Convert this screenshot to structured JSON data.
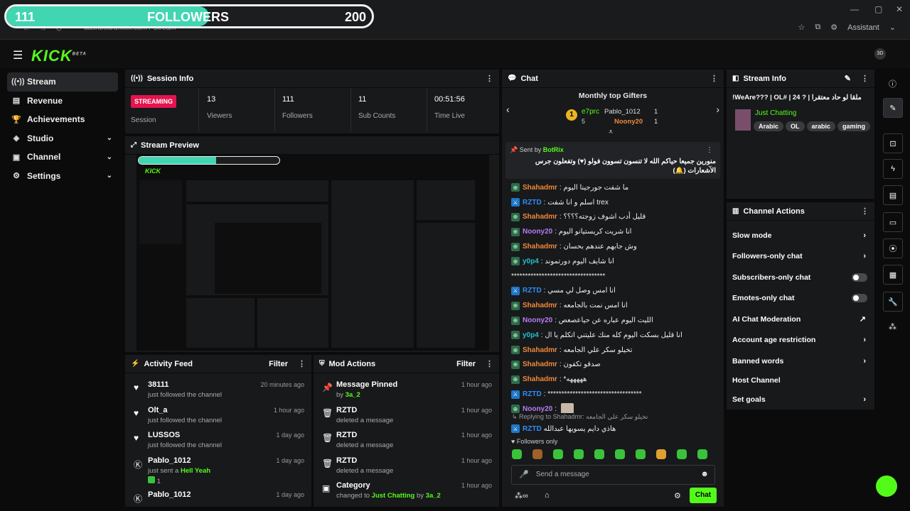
{
  "browser": {
    "address": "dashboard.kick.com / Stream",
    "assistant_label": "Assistant"
  },
  "follower_goal": {
    "current": "111",
    "label": "FOLLOWERS",
    "target": "200",
    "progress": 0.555
  },
  "sidebar": {
    "items": [
      {
        "label": "Stream",
        "icon": "stream-icon",
        "active": true
      },
      {
        "label": "Revenue",
        "icon": "revenue-icon"
      },
      {
        "label": "Achievements",
        "icon": "trophy-icon"
      },
      {
        "label": "Studio",
        "icon": "studio-icon",
        "expandable": true
      },
      {
        "label": "Channel",
        "icon": "channel-icon",
        "expandable": true
      },
      {
        "label": "Settings",
        "icon": "gear-icon",
        "expandable": true
      }
    ]
  },
  "session": {
    "title": "Session Info",
    "status": "STREAMING",
    "status_label": "Session",
    "stats": [
      {
        "value": "13",
        "label": "Viewers"
      },
      {
        "value": "111",
        "label": "Followers"
      },
      {
        "value": "11",
        "label": "Sub Counts"
      },
      {
        "value": "00:51:56",
        "label": "Time Live"
      }
    ]
  },
  "preview": {
    "title": "Stream Preview"
  },
  "activity": {
    "title": "Activity Feed",
    "filter": "Filter",
    "items": [
      {
        "name": "38111",
        "desc": "just followed the channel",
        "time": "20 minutes ago",
        "icon": "heart-icon"
      },
      {
        "name": "Olt_a",
        "desc": "just followed the channel",
        "time": "1 hour ago",
        "icon": "heart-icon"
      },
      {
        "name": "LUSSOS",
        "desc": "just followed the channel",
        "time": "1 day ago",
        "icon": "heart-icon"
      },
      {
        "name": "Pablo_1012",
        "desc": "just sent a",
        "highlight": "Hell Yeah",
        "extra": "1",
        "time": "1 day ago",
        "icon": "kick-icon"
      },
      {
        "name": "Pablo_1012",
        "desc": "",
        "time": "1 day ago",
        "icon": "kick-icon"
      }
    ]
  },
  "mod_actions": {
    "title": "Mod Actions",
    "filter": "Filter",
    "items": [
      {
        "name": "Message Pinned",
        "desc_pre": "by",
        "desc_hl": "3a_2",
        "time": "1 hour ago",
        "icon": "pin-icon"
      },
      {
        "name": "RZTD",
        "desc_pre": "deleted a message",
        "desc_hl": "",
        "time": "1 hour ago",
        "icon": "trash-icon"
      },
      {
        "name": "RZTD",
        "desc_pre": "deleted a message",
        "desc_hl": "",
        "time": "1 hour ago",
        "icon": "trash-icon"
      },
      {
        "name": "RZTD",
        "desc_pre": "deleted a message",
        "desc_hl": "",
        "time": "1 hour ago",
        "icon": "trash-icon"
      },
      {
        "name": "Category",
        "desc_pre": "changed to",
        "desc_hl": "Just Chatting",
        "desc_post": "by",
        "desc_hl2": "3a_2",
        "time": "1 hour ago",
        "icon": "category-icon"
      }
    ]
  },
  "chat": {
    "title": "Chat",
    "gifters_title": "Monthly top Gifters",
    "gifters": [
      {
        "name": "e7prc",
        "count": "5",
        "rank": "1"
      },
      {
        "name": "Pablo_1012",
        "count": "1"
      },
      {
        "name": "Noony20",
        "count": "1"
      }
    ],
    "pinned": {
      "sent_by": "Sent by",
      "author": "BotRix",
      "text": "منورين جميعا حياكم الله لا تنسون تسوون فولو (♥) وتفعلون جرس الاشعارات (🔔)"
    },
    "messages": [
      {
        "user": "Shahadmr",
        "color": "#f0883a",
        "text": "ما شفت جورجينا اليوم",
        "badge": "vip"
      },
      {
        "user": "RZTD",
        "color": "#2f8ef5",
        "text": "اسلم و انا شفت trex",
        "badge": "mod"
      },
      {
        "user": "Shahadmr",
        "color": "#f0883a",
        "text": "قليل أدب اشوف زوجته؟؟؟؟",
        "badge": "vip"
      },
      {
        "user": "Noony20",
        "color": "#b77cf5",
        "text": "انا شريت كريستيانو اليوم",
        "badge": "vip"
      },
      {
        "user": "Shahadmr",
        "color": "#f0883a",
        "text": "وش جابهم عندهم بحسان",
        "badge": "vip"
      },
      {
        "user": "y0p4",
        "color": "#21c0c8",
        "text": "انا شايف اليوم دورتموند",
        "badge": "vip"
      },
      {
        "user": "",
        "color": "#ffffff",
        "text": "**********************************",
        "badge": ""
      },
      {
        "user": "RZTD",
        "color": "#2f8ef5",
        "text": "انا امس وصل لي مسي",
        "badge": "mod"
      },
      {
        "user": "Shahadmr",
        "color": "#f0883a",
        "text": "انا امس نمت بالجامعه",
        "badge": "vip"
      },
      {
        "user": "Noony20",
        "color": "#b77cf5",
        "text": "الليت الیوم عباره عن حیاعصعص",
        "badge": "vip"
      },
      {
        "user": "y0p4",
        "color": "#21c0c8",
        "text": "انا قليل بسكت اليوم كله منك عليتني اتكلم يا ال",
        "badge": "vip"
      },
      {
        "user": "Shahadmr",
        "color": "#f0883a",
        "text": "تخيلو سكر علي الجامعه",
        "badge": "vip"
      },
      {
        "user": "Shahadmr",
        "color": "#f0883a",
        "text": "صدقو تكفون",
        "badge": "vip"
      },
      {
        "user": "Shahadmr",
        "color": "#f0883a",
        "text": "*هههههه",
        "badge": "vip"
      },
      {
        "user": "RZTD",
        "color": "#2f8ef5",
        "text": "**********************************",
        "badge": "mod"
      },
      {
        "user": "Noony20",
        "color": "#b77cf5",
        "text": "",
        "badge": "vip"
      }
    ],
    "reply": {
      "label": "Replying to Shahadmr:",
      "quoted": "تخيلو سكر علي الجامعه",
      "user": "RZTD",
      "text": "هاذي دايم يسويها عبدالله"
    },
    "followers_only": "Followers only",
    "placeholder": "Send a message",
    "send": "Chat"
  },
  "stream_info": {
    "title": "Stream Info",
    "stream_title": "ملقا لو حاد معتقرا | ? 24 | #WeAre??? | OL!",
    "category": "Just Chatting",
    "tags": [
      "Arabic",
      "OL",
      "arabic",
      "gaming"
    ]
  },
  "channel_actions": {
    "title": "Channel Actions",
    "items": [
      {
        "label": "Slow mode",
        "type": "arrow"
      },
      {
        "label": "Followers-only chat",
        "type": "arrow"
      },
      {
        "label": "Subscribers-only chat",
        "type": "toggle"
      },
      {
        "label": "Emotes-only chat",
        "type": "toggle"
      },
      {
        "label": "AI Chat Moderation",
        "type": "external"
      },
      {
        "label": "Account age restriction",
        "type": "arrow"
      },
      {
        "label": "Banned words",
        "type": "arrow"
      },
      {
        "label": "Host Channel",
        "type": "none"
      },
      {
        "label": "Set goals",
        "type": "arrow"
      }
    ]
  },
  "colors": {
    "accent": "#53fc18",
    "streaming": "#e4144e",
    "panel": "#18191b"
  }
}
